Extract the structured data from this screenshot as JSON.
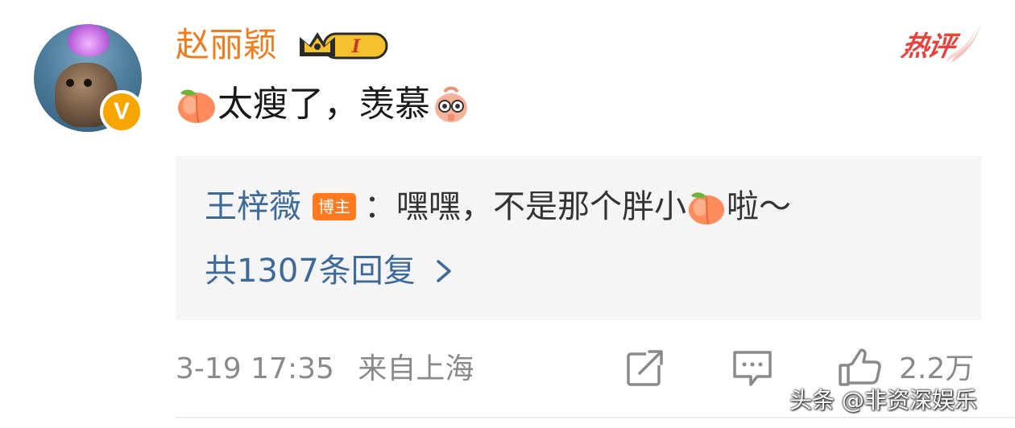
{
  "comment": {
    "username": "赵丽颖",
    "vip_level": "I",
    "hot_label": "热评",
    "text": "太瘦了，羡慕"
  },
  "reply": {
    "name": "王梓薇",
    "tag": "博主",
    "text_before": "：嘿嘿，不是那个胖小",
    "text_after": "啦～",
    "count_label": "共1307条回复"
  },
  "meta": {
    "datetime": "3-19 17:35",
    "location": "来自上海",
    "like_count": "2.2万"
  },
  "icons": {
    "repost": "repost-icon",
    "comment": "comment-icon",
    "like": "like-icon"
  },
  "watermark": "头条 @非资深娱乐",
  "colors": {
    "username": "#f07c1c",
    "link": "#3e6a9a",
    "hot": "#e8423c",
    "verified": "#f7a600",
    "muted": "#8a8a8a"
  }
}
